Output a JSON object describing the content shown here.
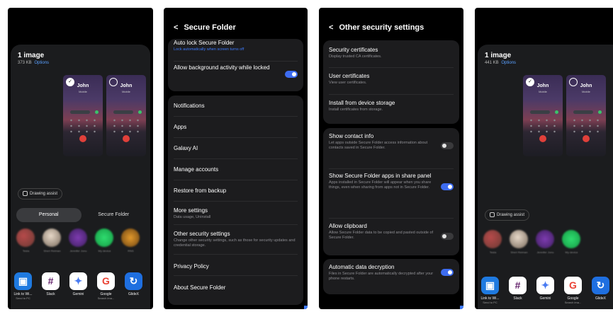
{
  "share_left": {
    "title": "1 image",
    "size": "373 KB",
    "options": "Options",
    "thumbs": [
      {
        "name": "John",
        "sub": "Mobile",
        "checked": true
      },
      {
        "name": "John",
        "sub": "Mobile",
        "checked": false
      }
    ],
    "drawing_assist": "Drawing assist",
    "tabs": [
      "Personal",
      "Secure Folder"
    ],
    "contacts": [
      "Tesla",
      "Sheri Reiman",
      "Jennifer Jonu",
      "My device",
      "RNS"
    ],
    "apps": [
      {
        "label": "Link to Wi...",
        "sub": "Send to PC",
        "icon": "link-to-windows-icon",
        "color": "#1f7ae0",
        "glyph": "▣"
      },
      {
        "label": "Slack",
        "sub": "",
        "icon": "slack-icon",
        "color": "#ffffff",
        "glyph": "#"
      },
      {
        "label": "Gemini",
        "sub": "",
        "icon": "gemini-icon",
        "color": "#ffffff",
        "glyph": "✦"
      },
      {
        "label": "Google",
        "sub": "Search ima...",
        "icon": "google-icon",
        "color": "#ffffff",
        "glyph": "G"
      },
      {
        "label": "GlideX",
        "sub": "",
        "icon": "glidex-icon",
        "color": "#1f6fe0",
        "glyph": "↻"
      }
    ]
  },
  "share_right": {
    "title": "1 image",
    "size": "441 KB",
    "options": "Options",
    "thumbs": [
      {
        "name": "John",
        "sub": "Mobile",
        "checked": true
      },
      {
        "name": "John",
        "sub": "Mobile",
        "checked": false
      }
    ],
    "drawing_assist": "Drawing assist",
    "contacts": [
      "Tesla",
      "Sheri Reiman",
      "Jennifer Jonu",
      "My device"
    ],
    "apps": [
      {
        "label": "Link to Wi...",
        "sub": "Send to PC"
      },
      {
        "label": "Slack",
        "sub": ""
      },
      {
        "label": "Gemini",
        "sub": ""
      },
      {
        "label": "Google",
        "sub": "Search ima..."
      },
      {
        "label": "GlideX",
        "sub": ""
      }
    ]
  },
  "secure_folder": {
    "title": "Secure Folder",
    "auto_lock": {
      "title": "Auto lock Secure Folder",
      "sub": "Lock automatically when screen turns off"
    },
    "background": {
      "title": "Allow background activity while locked",
      "on": true
    },
    "items": [
      {
        "title": "Notifications",
        "sub": ""
      },
      {
        "title": "Apps",
        "sub": ""
      },
      {
        "title": "Galaxy AI",
        "sub": ""
      },
      {
        "title": "Manage accounts",
        "sub": ""
      },
      {
        "title": "Restore from backup",
        "sub": ""
      },
      {
        "title": "More settings",
        "sub": "Data usage, Uninstall"
      },
      {
        "title": "Other security settings",
        "sub": "Change other security settings, such as those for security updates and credential storage."
      },
      {
        "title": "Privacy Policy",
        "sub": ""
      },
      {
        "title": "About Secure Folder",
        "sub": ""
      }
    ]
  },
  "other_security": {
    "title": "Other security settings",
    "certs": [
      {
        "title": "Security certificates",
        "sub": "Display trusted CA certificates."
      },
      {
        "title": "User certificates",
        "sub": "View user certificates."
      },
      {
        "title": "Install from device storage",
        "sub": "Install certificates from storage."
      }
    ],
    "toggles": [
      {
        "title": "Show contact info",
        "sub": "Let apps outside Secure Folder access information about contacts saved in Secure Folder.",
        "on": false
      },
      {
        "title": "Show Secure Folder apps in share panel",
        "sub": "Apps installed in Secure Folder will appear when you share things, even when sharing from apps not in Secure Folder.",
        "on": true
      },
      {
        "title": "Allow clipboard",
        "sub": "Allow Secure Folder data to be copied and pasted outside of Secure Folder.",
        "on": false
      }
    ],
    "decryption": {
      "title": "Automatic data decryption",
      "sub": "Files in Secure Folder are automatically decrypted after your phone restarts.",
      "on": true
    }
  }
}
